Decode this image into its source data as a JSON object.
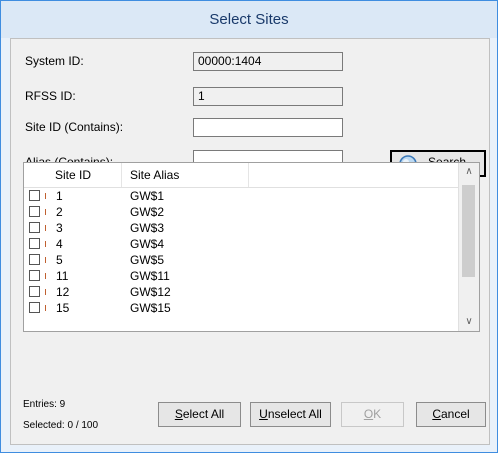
{
  "window": {
    "title": "Select Sites"
  },
  "form": {
    "system_id_label": "System ID:",
    "system_id_value": "00000:1404",
    "rfss_id_label": "RFSS ID:",
    "rfss_id_value": "1",
    "site_id_label": "Site ID (Contains):",
    "site_id_value": "",
    "alias_label": "Alias (Contains):",
    "alias_value": "",
    "search_button": {
      "pre": "",
      "ul": "S",
      "post": "earch..."
    }
  },
  "table": {
    "headers": [
      "Site ID",
      "Site Alias"
    ],
    "rows": [
      {
        "site_id": "1",
        "alias": "GW$1",
        "checked": false
      },
      {
        "site_id": "2",
        "alias": "GW$2",
        "checked": false
      },
      {
        "site_id": "3",
        "alias": "GW$3",
        "checked": false
      },
      {
        "site_id": "4",
        "alias": "GW$4",
        "checked": false
      },
      {
        "site_id": "5",
        "alias": "GW$5",
        "checked": false
      },
      {
        "site_id": "11",
        "alias": "GW$11",
        "checked": false
      },
      {
        "site_id": "12",
        "alias": "GW$12",
        "checked": false
      },
      {
        "site_id": "15",
        "alias": "GW$15",
        "checked": false
      }
    ],
    "scroll_up_icon": "chevron-up-icon",
    "scroll_down_icon": "chevron-down-icon"
  },
  "footer": {
    "entries_label": "Entries: 9",
    "selected_label": "Selected: 0 / 100",
    "select_all": {
      "pre": "",
      "ul": "S",
      "post": "elect All"
    },
    "unselect_all": {
      "pre": "",
      "ul": "U",
      "post": "nselect All"
    },
    "ok": {
      "pre": "",
      "ul": "O",
      "post": "K"
    },
    "cancel": {
      "pre": "",
      "ul": "C",
      "post": "ancel"
    }
  },
  "colors": {
    "border_accent": "#3f8de0",
    "title_text": "#1a3a6b",
    "disabled_text": "#a0a0a0"
  }
}
